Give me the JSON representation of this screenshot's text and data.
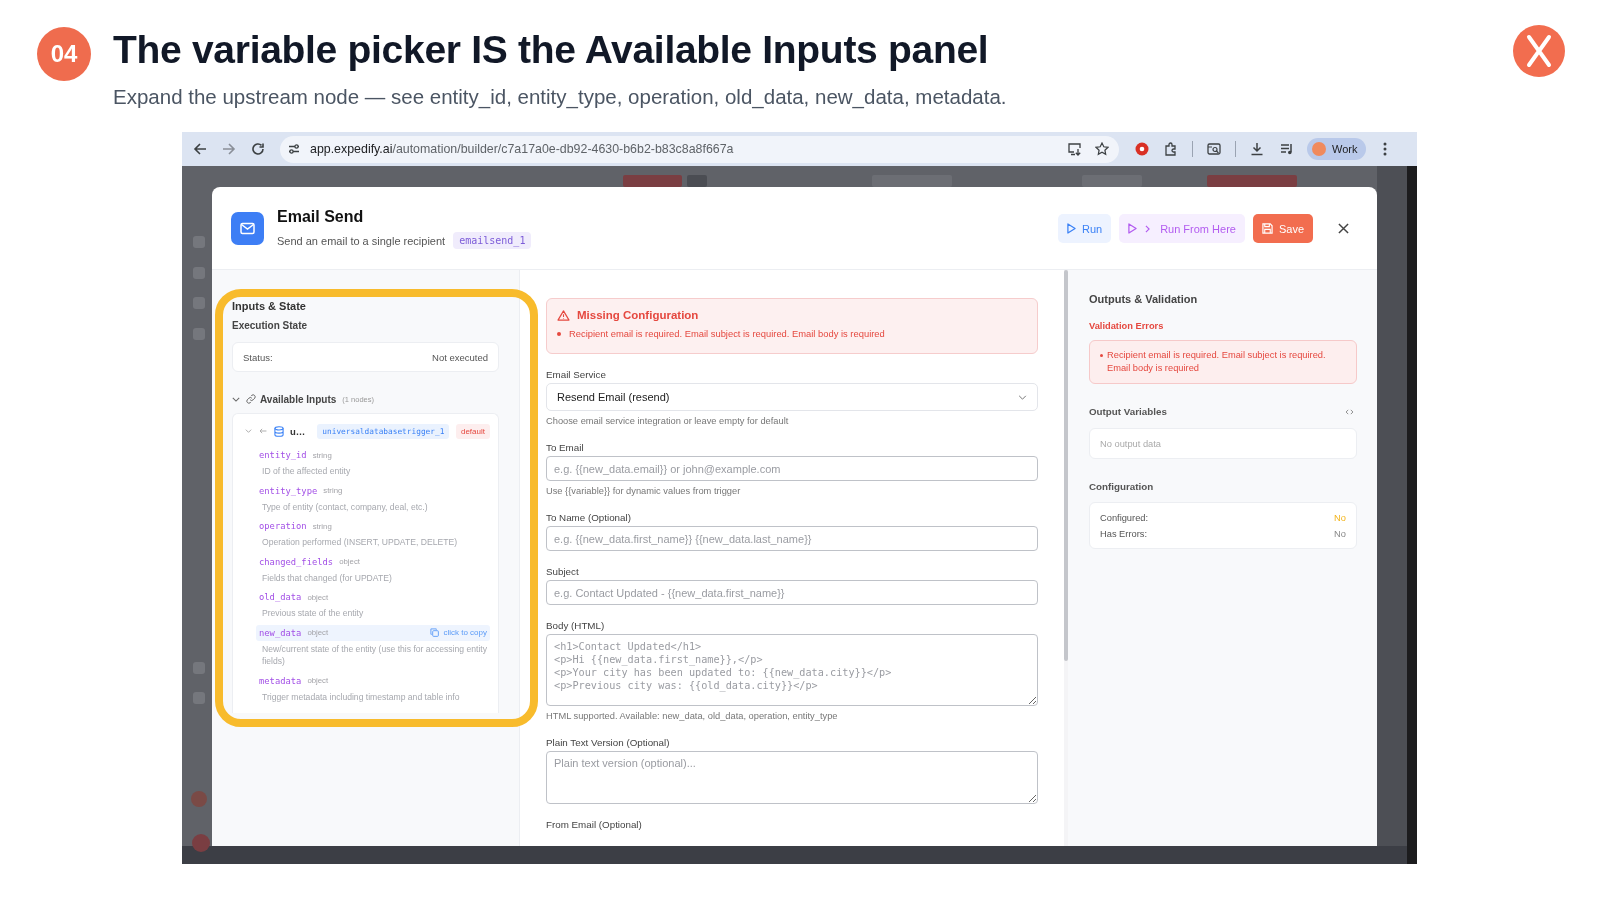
{
  "slide": {
    "step": "04",
    "title": "The variable picker IS the Available Inputs panel",
    "subtitle": "Expand the upstream node — see entity_id, entity_type, operation, old_data, new_data, metadata."
  },
  "browser": {
    "url_host": "app.expedify.ai",
    "url_path": "/automation/builder/c7a17a0e-db92-4630-b6b2-b83c8a8f667a",
    "profile": "Work"
  },
  "modal": {
    "title": "Email Send",
    "subtitle": "Send an email to a single recipient",
    "node_id": "emailsend_1",
    "actions": [
      {
        "kind": "run",
        "label": "Run"
      },
      {
        "kind": "run_from_here",
        "label": "Run From Here"
      },
      {
        "kind": "save",
        "label": "Save"
      }
    ]
  },
  "inputs_panel": {
    "highlighted": true,
    "heading": "Inputs & State",
    "execution_state": {
      "heading": "Execution State",
      "label": "Status:",
      "value": "Not executed"
    },
    "available_inputs": {
      "label": "Available Inputs",
      "count": "(1 nodes)",
      "expanded": true,
      "nodes": [
        {
          "name": "u…",
          "node_id": "universaldatabasetrigger_1",
          "badge": "default",
          "expanded": true,
          "copy_hint": "click to copy",
          "fields": [
            {
              "name": "entity_id",
              "type": "string",
              "description": "ID of the affected entity",
              "hovered": false
            },
            {
              "name": "entity_type",
              "type": "string",
              "description": "Type of entity (contact, company, deal, etc.)",
              "hovered": false
            },
            {
              "name": "operation",
              "type": "string",
              "description": "Operation performed (INSERT, UPDATE, DELETE)",
              "hovered": false
            },
            {
              "name": "changed_fields",
              "type": "object",
              "description": "Fields that changed (for UPDATE)",
              "hovered": false
            },
            {
              "name": "old_data",
              "type": "object",
              "description": "Previous state of the entity",
              "hovered": false
            },
            {
              "name": "new_data",
              "type": "object",
              "description": "New/current state of the entity (use this for accessing entity fields)",
              "hovered": true
            },
            {
              "name": "metadata",
              "type": "object",
              "description": "Trigger metadata including timestamp and table info",
              "hovered": false
            }
          ]
        }
      ]
    }
  },
  "form": {
    "alert": {
      "title": "Missing Configuration",
      "items": [
        "Recipient email is required. Email subject is required. Email body is required"
      ]
    },
    "fields": [
      {
        "kind": "select",
        "label": "Email Service",
        "value": "Resend Email (resend)",
        "help": "Choose email service integration or leave empty for default"
      },
      {
        "kind": "input",
        "label": "To Email",
        "placeholder": "e.g. {{new_data.email}} or john@example.com",
        "help": "Use {{variable}} for dynamic values from trigger"
      },
      {
        "kind": "input",
        "label": "To Name (Optional)",
        "placeholder": "e.g. {{new_data.first_name}} {{new_data.last_name}}"
      },
      {
        "kind": "input",
        "label": "Subject",
        "placeholder": "e.g. Contact Updated - {{new_data.first_name}}"
      },
      {
        "kind": "code",
        "label": "Body (HTML)",
        "placeholder": "<h1>Contact Updated</h1>\n<p>Hi {{new_data.first_name}},</p>\n<p>Your city has been updated to: {{new_data.city}}</p>\n<p>Previous city was: {{old_data.city}}</p>",
        "help": "HTML supported. Available: new_data, old_data, operation, entity_type"
      },
      {
        "kind": "textarea",
        "label": "Plain Text Version (Optional)",
        "placeholder": "Plain text version (optional)..."
      },
      {
        "kind": "label",
        "label": "From Email (Optional)"
      }
    ]
  },
  "outputs_panel": {
    "heading": "Outputs & Validation",
    "validation": {
      "heading": "Validation Errors",
      "items": [
        "Recipient email is required. Email subject is required. Email body is required"
      ]
    },
    "output_variables": {
      "heading": "Output Variables",
      "empty": "No output data"
    },
    "configuration": {
      "heading": "Configuration",
      "rows": [
        {
          "label": "Configured:",
          "value": "No",
          "kind": "warning"
        },
        {
          "label": "Has Errors:",
          "value": "No",
          "kind": "plain"
        }
      ]
    }
  }
}
